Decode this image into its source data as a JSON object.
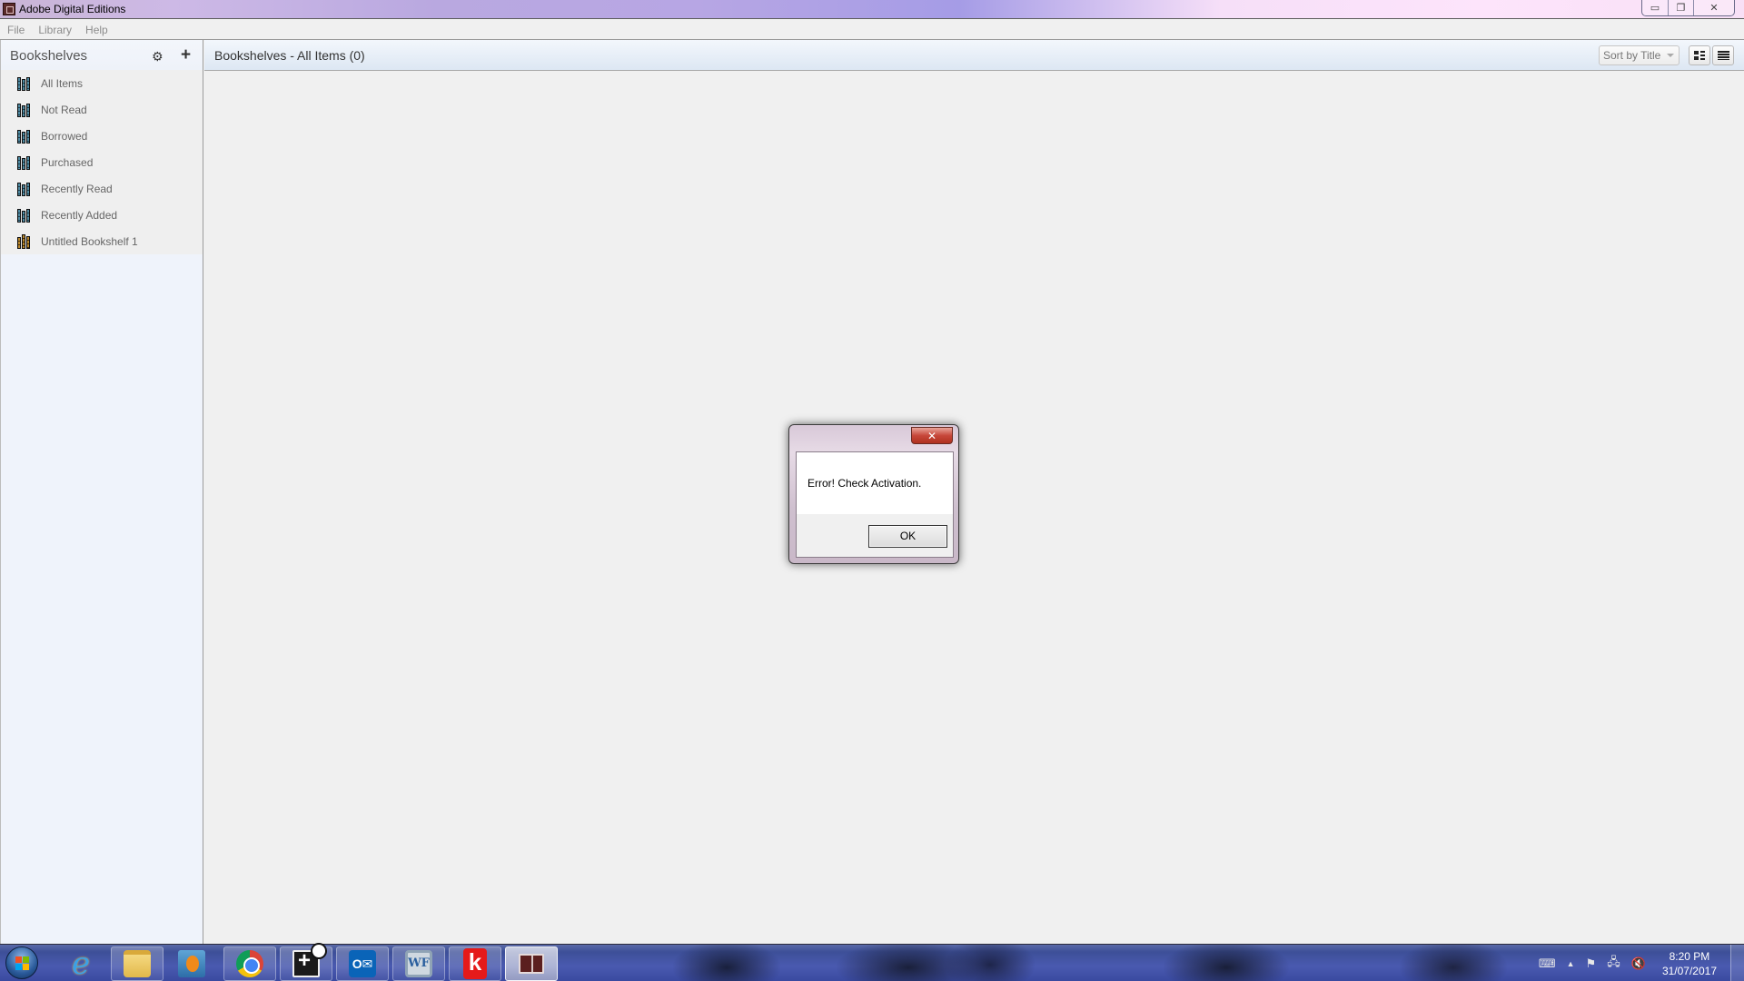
{
  "window": {
    "title": "Adobe Digital Editions",
    "controls": {
      "minimize": "▭",
      "restore": "❐",
      "close": "✕"
    }
  },
  "menubar": {
    "items": [
      "File",
      "Library",
      "Help"
    ]
  },
  "sidebar": {
    "title": "Bookshelves",
    "settings_icon": "⚙",
    "add_icon": "+",
    "items": [
      {
        "label": "All Items",
        "icon": "bookshelf-icon",
        "color": "#4e8aa2"
      },
      {
        "label": "Not Read",
        "icon": "bookshelf-icon",
        "color": "#4e8aa2"
      },
      {
        "label": "Borrowed",
        "icon": "bookshelf-icon",
        "color": "#4e8aa2"
      },
      {
        "label": "Purchased",
        "icon": "bookshelf-icon",
        "color": "#4e8aa2"
      },
      {
        "label": "Recently Read",
        "icon": "bookshelf-icon",
        "color": "#4e8aa2"
      },
      {
        "label": "Recently Added",
        "icon": "bookshelf-icon",
        "color": "#4e8aa2"
      },
      {
        "label": "Untitled Bookshelf 1",
        "icon": "custom-bookshelf-icon",
        "color": "#b8862a"
      }
    ]
  },
  "main": {
    "title": "Bookshelves - All Items (0)",
    "sort": {
      "selected": "Sort by Title"
    },
    "view_modes": [
      "thumbnail-view",
      "list-view"
    ]
  },
  "dialog": {
    "close_label": "✕",
    "message": "Error! Check Activation.",
    "ok_label": "OK"
  },
  "taskbar": {
    "apps": [
      {
        "name": "internet-explorer",
        "label": "e"
      },
      {
        "name": "file-explorer",
        "label": ""
      },
      {
        "name": "media-player",
        "label": ""
      },
      {
        "name": "chrome",
        "label": ""
      },
      {
        "name": "remote-monitor",
        "label": ""
      },
      {
        "name": "outlook",
        "label": "O✉"
      },
      {
        "name": "wf-app",
        "label": "WF"
      },
      {
        "name": "k-app",
        "label": "k"
      },
      {
        "name": "adobe-digital-editions",
        "label": ""
      }
    ],
    "tray": {
      "keyboard": "⌨",
      "show_hidden": "▲",
      "action_center": "⚑",
      "network": "🖧",
      "volume": "🔇"
    },
    "clock": {
      "time": "8:20 PM",
      "date": "31/07/2017"
    }
  }
}
